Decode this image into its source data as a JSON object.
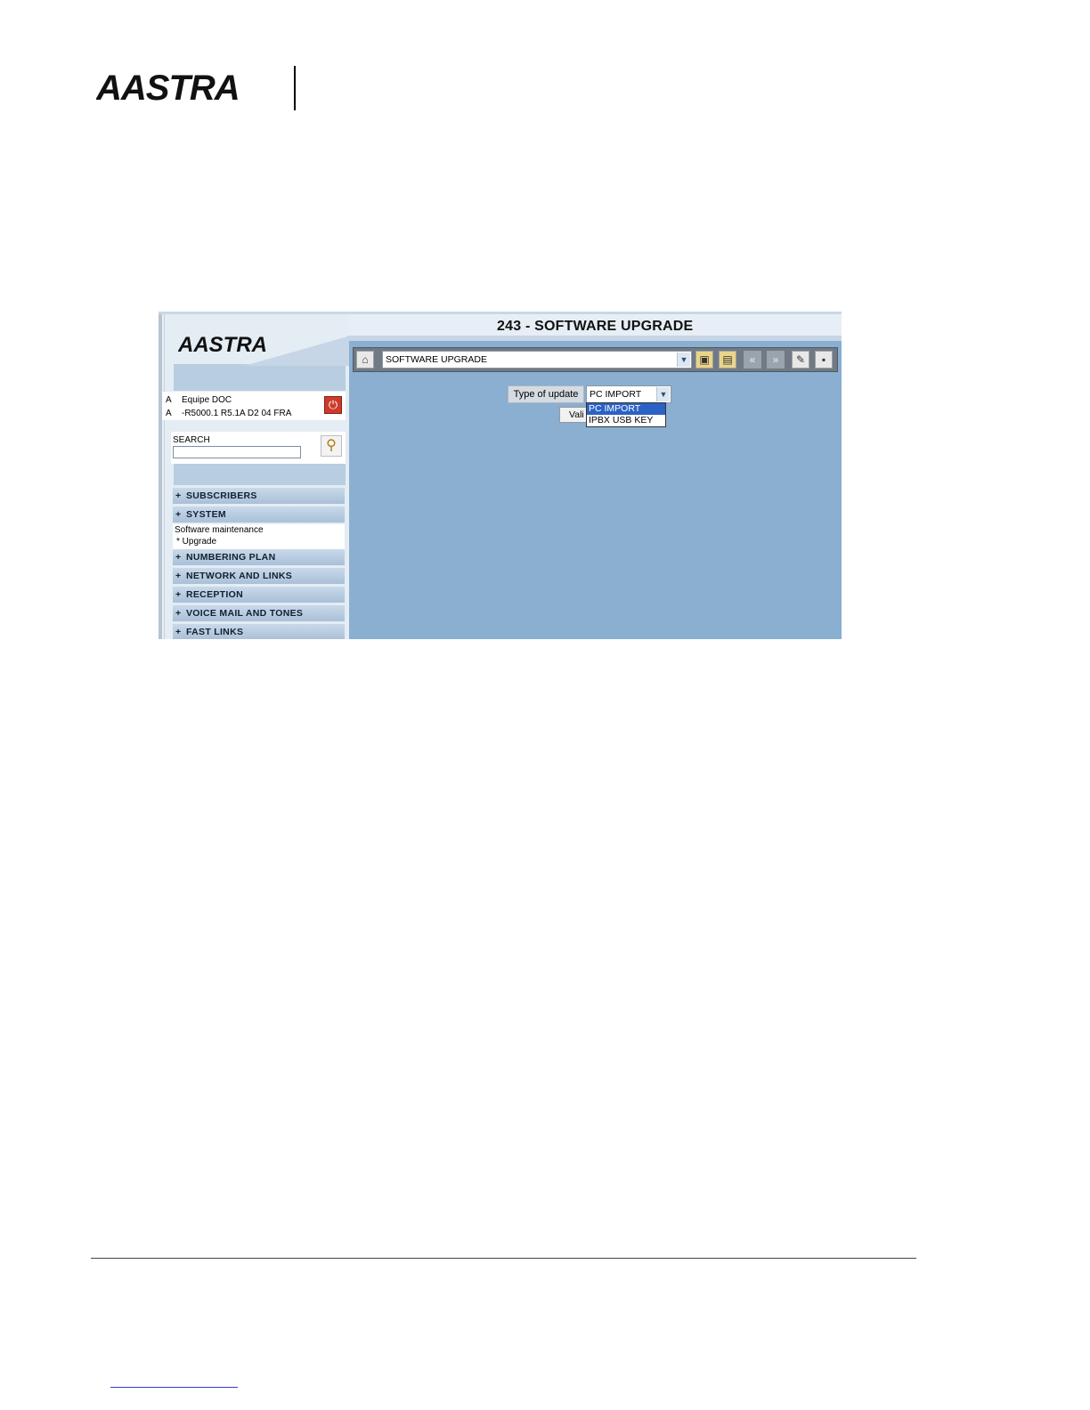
{
  "doc_header": {
    "logo_text": "AASTRA"
  },
  "app": {
    "logo_text": "AASTRA",
    "title": "243 - SOFTWARE UPGRADE",
    "user": {
      "line1_prefix": "A",
      "line1": "Equipe DOC",
      "line2_prefix": "A",
      "line2": "-R5000.1 R5.1A D2 04 FRA"
    },
    "search": {
      "label": "SEARCH",
      "value": ""
    },
    "nav": [
      {
        "label": "SUBSCRIBERS"
      },
      {
        "label": "SYSTEM"
      },
      {
        "label": "NUMBERING PLAN"
      },
      {
        "label": "NETWORK AND LINKS"
      },
      {
        "label": "RECEPTION"
      },
      {
        "label": "VOICE MAIL AND TONES"
      },
      {
        "label": "FAST LINKS"
      }
    ],
    "nav_plus": "+",
    "system_sub": {
      "line1": "Software maintenance",
      "line2": "* Upgrade"
    },
    "toolbar": {
      "selected_page": "SOFTWARE UPGRADE"
    },
    "form": {
      "type_label": "Type of update",
      "type_value": "PC IMPORT",
      "validate_label": "Vali",
      "options": [
        "PC IMPORT",
        "IPBX USB KEY"
      ]
    },
    "colors": {
      "main_bg": "#8aafd1",
      "highlight": "#2c62c5"
    }
  }
}
